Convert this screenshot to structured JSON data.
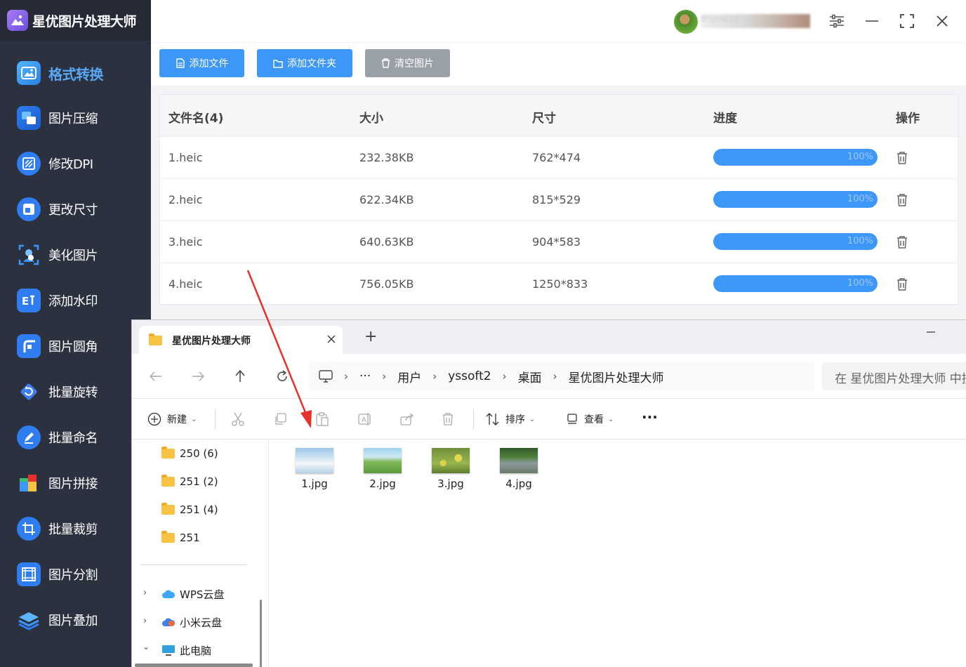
{
  "app": {
    "title": "星优图片处理大师",
    "user_name": "iFl2rsb12"
  },
  "sidebar": {
    "items": [
      {
        "label": "格式转换",
        "icon": "image-convert-icon",
        "active": true
      },
      {
        "label": "图片压缩",
        "icon": "compress-icon"
      },
      {
        "label": "修改DPI",
        "icon": "dpi-icon"
      },
      {
        "label": "更改尺寸",
        "icon": "resize-icon"
      },
      {
        "label": "美化图片",
        "icon": "beautify-icon"
      },
      {
        "label": "添加水印",
        "icon": "watermark-icon"
      },
      {
        "label": "图片圆角",
        "icon": "rounded-corner-icon"
      },
      {
        "label": "批量旋转",
        "icon": "rotate-icon"
      },
      {
        "label": "批量命名",
        "icon": "rename-icon"
      },
      {
        "label": "图片拼接",
        "icon": "stitch-icon"
      },
      {
        "label": "批量裁剪",
        "icon": "crop-icon"
      },
      {
        "label": "图片分割",
        "icon": "split-icon"
      },
      {
        "label": "图片叠加",
        "icon": "overlay-icon"
      }
    ]
  },
  "toolbar": {
    "add_file": "添加文件",
    "add_folder": "添加文件夹",
    "clear": "清空图片"
  },
  "table": {
    "headers": {
      "name": "文件名(4)",
      "size": "大小",
      "dims": "尺寸",
      "progress": "进度",
      "action": "操作"
    },
    "rows": [
      {
        "name": "1.heic",
        "size": "232.38KB",
        "dims": "762*474",
        "progress": 1.0,
        "progress_label": "100%"
      },
      {
        "name": "2.heic",
        "size": "622.34KB",
        "dims": "815*529",
        "progress": 1.0,
        "progress_label": "100%"
      },
      {
        "name": "3.heic",
        "size": "640.63KB",
        "dims": "904*583",
        "progress": 1.0,
        "progress_label": "100%"
      },
      {
        "name": "4.heic",
        "size": "756.05KB",
        "dims": "1250*833",
        "progress": 1.0,
        "progress_label": "100%"
      }
    ]
  },
  "colors": {
    "sidebar_bg": "#2c3140",
    "accent_blue": "#3d97f6",
    "clear_button": "#9aa0a8",
    "arrow_red": "#e8312b"
  },
  "explorer": {
    "tab_title": "星优图片处理大师",
    "new_tab": "+",
    "breadcrumb": {
      "more": "···",
      "users": "用户",
      "user": "yssoft2",
      "desktop": "桌面",
      "folder": "星优图片处理大师"
    },
    "search_placeholder": "在 星优图片处理大师 中搜索",
    "commands": {
      "new": "新建",
      "sort": "排序",
      "view": "查看",
      "more": "···"
    },
    "nav_folders": [
      "250 (6)",
      "251 (2)",
      "251 (4)",
      "251"
    ],
    "nav_drives": [
      "WPS云盘",
      "小米云盘",
      "此电脑"
    ],
    "files": [
      "1.jpg",
      "2.jpg",
      "3.jpg",
      "4.jpg"
    ]
  }
}
